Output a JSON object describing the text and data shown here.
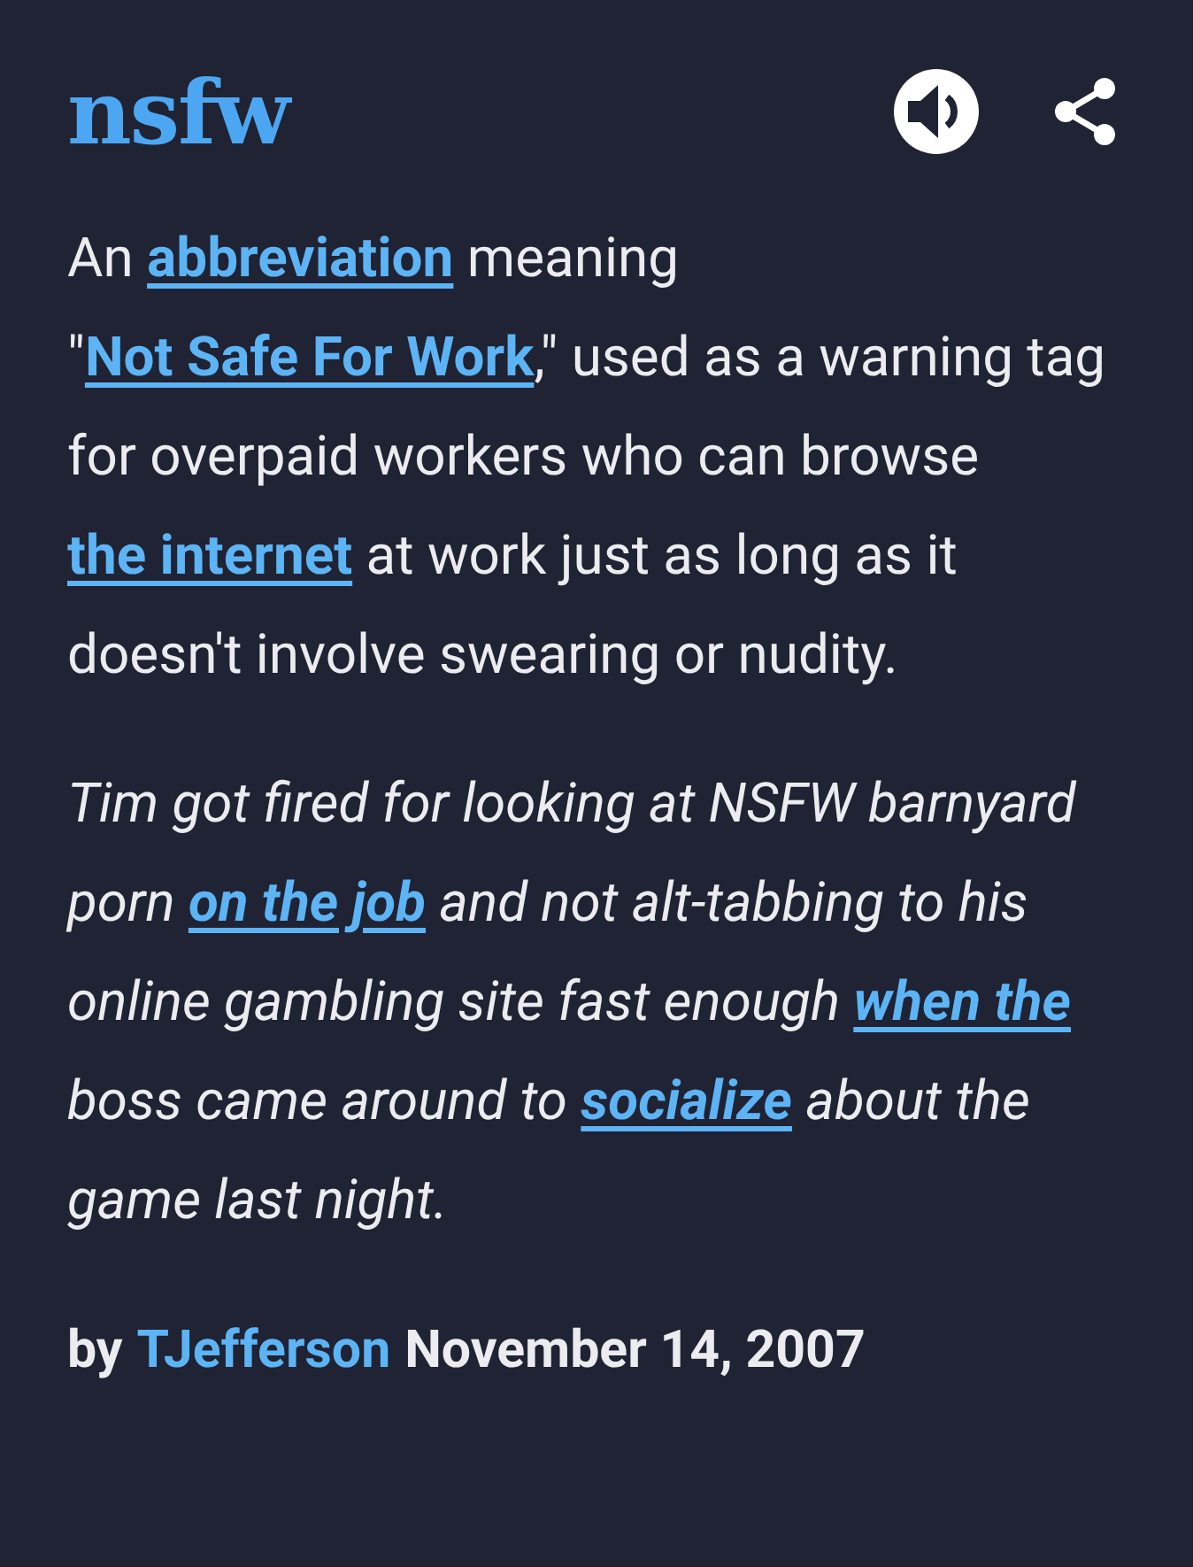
{
  "title": "nsfw",
  "definition": [
    {
      "kind": "text",
      "text": "An "
    },
    {
      "kind": "link",
      "text": "abbreviation"
    },
    {
      "kind": "text",
      "text": " meaning \""
    },
    {
      "kind": "link",
      "text": "Not Safe For Work"
    },
    {
      "kind": "text",
      "text": ",\" used as a warning tag for overpaid workers who can browse "
    },
    {
      "kind": "link",
      "text": "the internet"
    },
    {
      "kind": "text",
      "text": " at work just as long as it doesn't involve swearing or nudity."
    }
  ],
  "example": [
    {
      "kind": "text",
      "text": "Tim got fired for looking at NSFW barnyard porn "
    },
    {
      "kind": "link",
      "text": "on the job"
    },
    {
      "kind": "text",
      "text": " and not alt-tabbing to his online gambling site fast enough "
    },
    {
      "kind": "link",
      "text": "when the"
    },
    {
      "kind": "text",
      "text": " boss came around to "
    },
    {
      "kind": "link",
      "text": "socialize"
    },
    {
      "kind": "text",
      "text": " about the game last night."
    }
  ],
  "byline": {
    "prefix": "by",
    "author": "TJefferson",
    "date": "November 14, 2007"
  }
}
